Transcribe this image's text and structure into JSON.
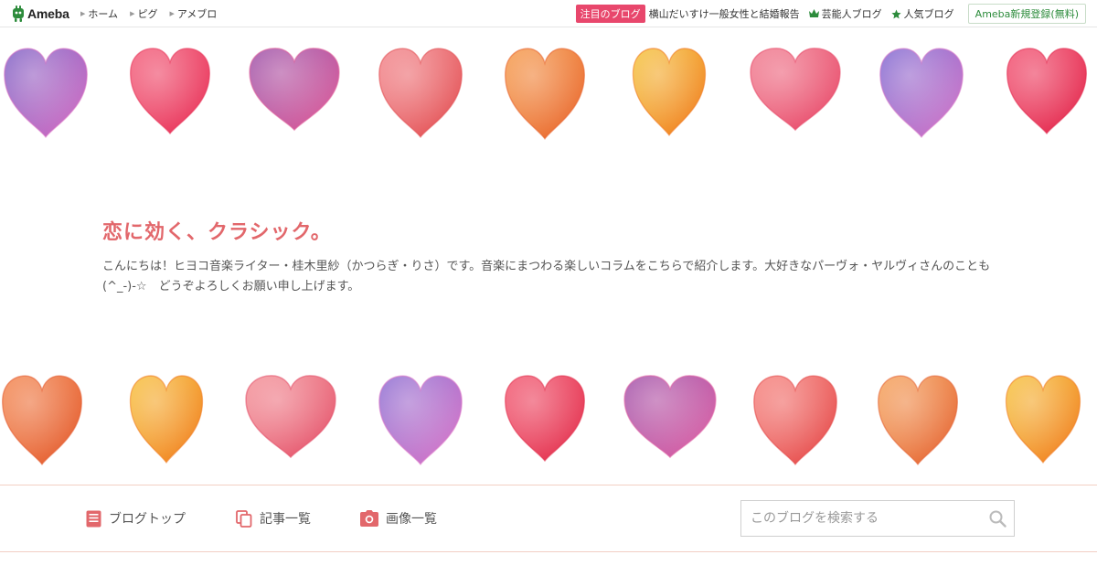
{
  "topbar": {
    "logo_text": "Ameba",
    "nav": [
      "ホーム",
      "ピグ",
      "アメブロ"
    ],
    "featured_badge": "注目のブログ",
    "featured_link": "横山だいすけ一般女性と結婚報告",
    "celebrity_blog": "芸能人ブログ",
    "popular_blog": "人気ブログ",
    "signup": "Ameba新規登録(無料)"
  },
  "blog": {
    "title": "恋に効く、クラシック。",
    "description": "こんにちは！ヒヨコ音楽ライター・桂木里紗（かつらぎ・りさ）です。音楽にまつわる楽しいコラムをこちらで紹介します。大好きなパーヴォ・ヤルヴィさんのことも(^_-)-☆　どうぞよろしくお願い申し上げます。"
  },
  "bottom_nav": {
    "blog_top": "ブログトップ",
    "article_list": "記事一覧",
    "image_list": "画像一覧",
    "search_placeholder": "このブログを検索する"
  },
  "colors": {
    "title": "#e2676b",
    "badge": "#e8476c",
    "brand_green": "#2d8c3c",
    "divider": "#f2cfc4"
  },
  "hearts": {
    "row1": [
      {
        "c1": "#7d5fc4",
        "c2": "#d76fc3"
      },
      {
        "c1": "#f25b78",
        "c2": "#e8345a"
      },
      {
        "c1": "#9b4fa7",
        "c2": "#e05f9a"
      },
      {
        "c1": "#f2848a",
        "c2": "#e24f52"
      },
      {
        "c1": "#f59a4a",
        "c2": "#e8652f"
      },
      {
        "c1": "#f5c33a",
        "c2": "#f07a22"
      },
      {
        "c1": "#f07a8e",
        "c2": "#e84a6a"
      },
      {
        "c1": "#7d66d0",
        "c2": "#d778c8"
      },
      {
        "c1": "#f25070",
        "c2": "#e22a4e"
      }
    ],
    "row2": [
      {
        "c1": "#f3864f",
        "c2": "#e35b2f"
      },
      {
        "c1": "#f7c03a",
        "c2": "#f07c22"
      },
      {
        "c1": "#f39097",
        "c2": "#e4516a"
      },
      {
        "c1": "#8a6bd1",
        "c2": "#dd78c8"
      },
      {
        "c1": "#f2566f",
        "c2": "#e2324f"
      },
      {
        "c1": "#a050a8",
        "c2": "#e065a6"
      },
      {
        "c1": "#f6827d",
        "c2": "#e44848"
      },
      {
        "c1": "#f5a25a",
        "c2": "#e46234"
      },
      {
        "c1": "#f6c23a",
        "c2": "#f07a22"
      }
    ]
  }
}
